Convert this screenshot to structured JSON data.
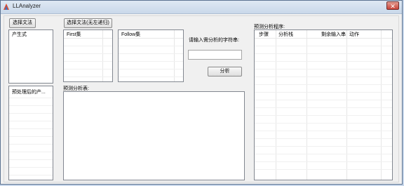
{
  "app": {
    "title": "LLAnalyzer"
  },
  "buttons": {
    "select_grammar": "选择文法",
    "select_grammar_no_left_recursion": "选择文法(无左递归)",
    "analyze": "分析"
  },
  "labels": {
    "input_prompt": "请输入需分析的字符串:",
    "predict_table": "预测分析表:",
    "predict_process": "预测分析程序:"
  },
  "lists": {
    "productions_header": "产生式",
    "processed_productions_header": "预处理后的产..."
  },
  "first_table": {
    "columns": [
      "First集"
    ]
  },
  "follow_table": {
    "columns": [
      "Follow集"
    ]
  },
  "process_table": {
    "columns": [
      "步骤",
      "分析栈",
      "剩余输入串",
      "动作"
    ]
  },
  "input": {
    "value": "",
    "placeholder": ""
  }
}
